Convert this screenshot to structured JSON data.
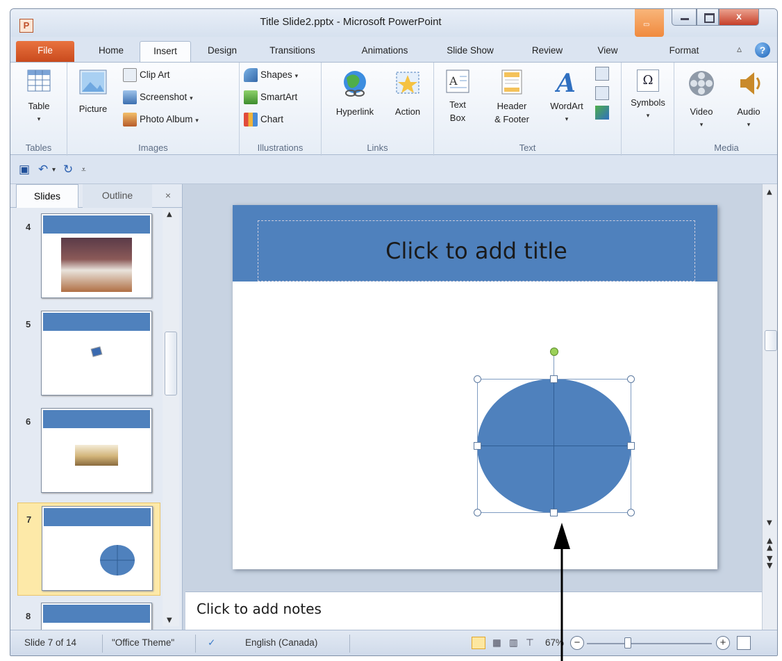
{
  "window": {
    "title": "Title Slide2.pptx - Microsoft PowerPoint",
    "app_icon": "P",
    "close_label": "x"
  },
  "tabs": {
    "file": "File",
    "home": "Home",
    "insert": "Insert",
    "design": "Design",
    "transitions": "Transitions",
    "animations": "Animations",
    "slideshow": "Slide Show",
    "review": "Review",
    "view": "View",
    "format": "Format"
  },
  "ribbon": {
    "tables": {
      "table": "Table",
      "label": "Tables"
    },
    "images": {
      "picture": "Picture",
      "clipart": "Clip Art",
      "screenshot": "Screenshot",
      "photoalbum": "Photo Album",
      "label": "Images"
    },
    "illustrations": {
      "shapes": "Shapes",
      "smartart": "SmartArt",
      "chart": "Chart",
      "label": "Illustrations"
    },
    "links": {
      "hyperlink": "Hyperlink",
      "action": "Action",
      "label": "Links"
    },
    "text": {
      "textbox1": "Text",
      "textbox2": "Box",
      "header1": "Header",
      "header2": "& Footer",
      "wordart": "WordArt",
      "label": "Text"
    },
    "symbols": {
      "symbols": "Symbols",
      "omega": "Ω"
    },
    "media": {
      "video": "Video",
      "audio": "Audio",
      "label": "Media"
    }
  },
  "panel": {
    "tab_slides": "Slides",
    "tab_outline": "Outline",
    "close": "×",
    "slide_numbers": [
      "4",
      "5",
      "6",
      "7",
      "8"
    ]
  },
  "slide": {
    "title_placeholder": "Click to add title"
  },
  "notes": {
    "placeholder": "Click to add notes"
  },
  "status": {
    "slide_info": "Slide 7 of 14",
    "theme": "\"Office Theme\"",
    "language": "English (Canada)",
    "zoom": "67%"
  },
  "colors": {
    "accent": "#4f81bd",
    "file_tab": "#d35a2a"
  }
}
